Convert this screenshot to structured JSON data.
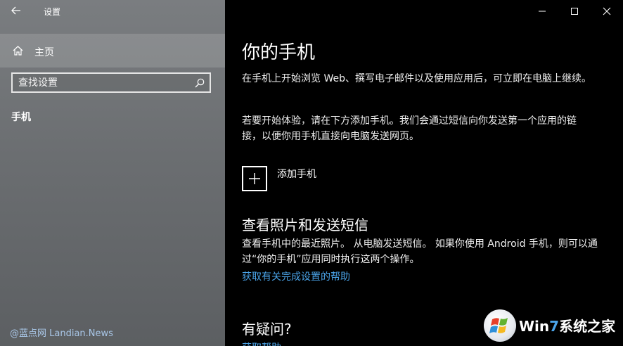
{
  "window": {
    "app_title": "设置"
  },
  "sidebar": {
    "home_label": "主页",
    "search_placeholder": "查找设置",
    "search_value": "",
    "nav_item": "手机",
    "watermark": "@蓝点网 Landian.News"
  },
  "main": {
    "title": "你的手机",
    "paragraph1": "在手机上开始浏览 Web、撰写电子邮件以及使用应用后，可立即在电脑上继续。",
    "paragraph2": "若要开始体验，请在下方添加手机。我们会通过短信向你发送第一个应用的链接，以便你用手机直接向电脑发送网页。",
    "add_phone_label": "添加手机",
    "section_title": "查看照片和发送短信",
    "paragraph3": "查看手机中的最近照片。 从电脑发送短信。 如果你使用 Android 手机，则可以通过“你的手机”应用同时执行这两个操作。",
    "help_link": "获取有关完成设置的帮助",
    "faq_title": "有疑问?",
    "get_help_link": "获取帮助"
  },
  "watermark_logo": {
    "win": "Wi",
    "n": "n",
    "seven": "7",
    "rest": "系统之家"
  },
  "colors": {
    "link": "#4aa3e8",
    "content_bg": "#000000",
    "sidebar_bg": "#6b6e71"
  },
  "icons": {
    "back": "back-arrow-icon",
    "home": "home-icon",
    "search": "search-icon",
    "minimize": "minimize-icon",
    "maximize": "maximize-icon",
    "close": "close-icon",
    "add": "plus-icon"
  }
}
